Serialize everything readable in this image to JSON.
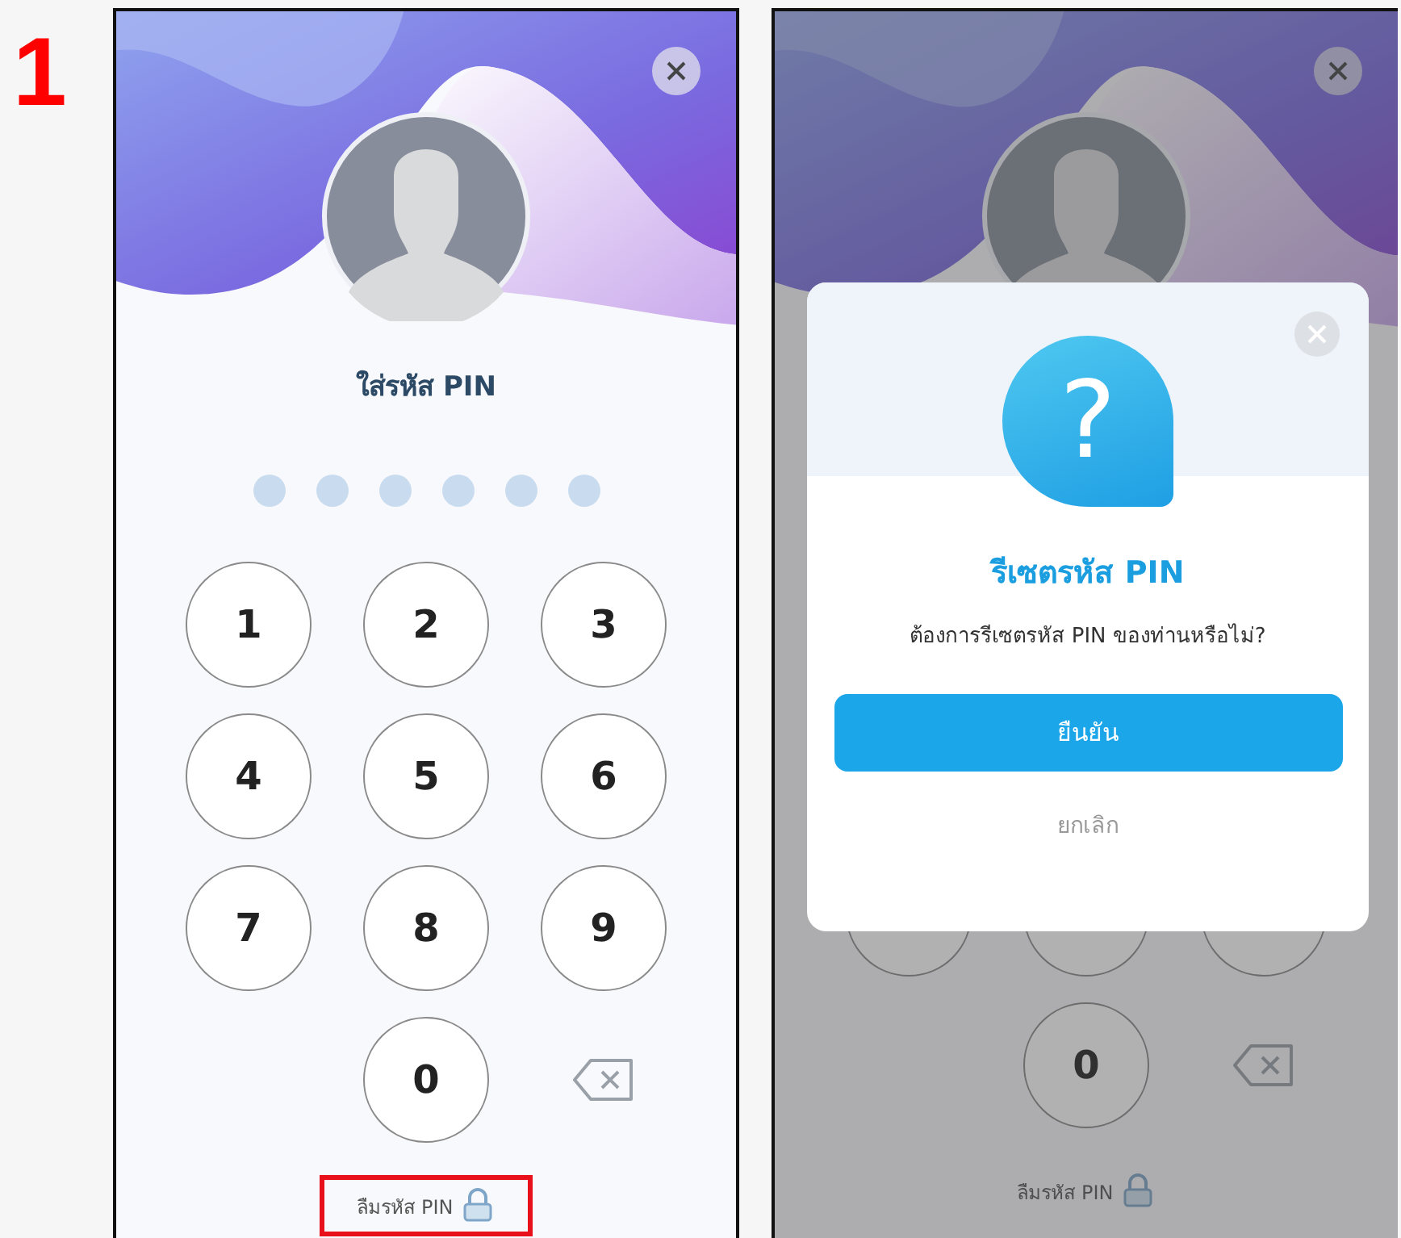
{
  "step_number": "1",
  "left_phone": {
    "title": "ใส่รหัส PIN",
    "pin_dots": [
      {
        "filled": false
      },
      {
        "filled": false
      },
      {
        "filled": false
      },
      {
        "filled": false
      },
      {
        "filled": false
      },
      {
        "filled": false
      }
    ],
    "keys": [
      "1",
      "2",
      "3",
      "4",
      "5",
      "6",
      "7",
      "8",
      "9",
      "0"
    ],
    "forgot_link": "ลืมรหัส PIN",
    "forgot_highlighted": true
  },
  "right_phone": {
    "keys": [
      "0"
    ],
    "forgot_link": "ลืมรหัส PIN",
    "forgot_highlighted": false,
    "dialog": {
      "icon_glyph": "?",
      "title": "รีเซตรหัส PIN",
      "message": "ต้องการรีเซตรหัส PIN ของท่านหรือไม่?",
      "confirm": "ยืนยัน",
      "cancel": "ยกเลิก"
    }
  }
}
